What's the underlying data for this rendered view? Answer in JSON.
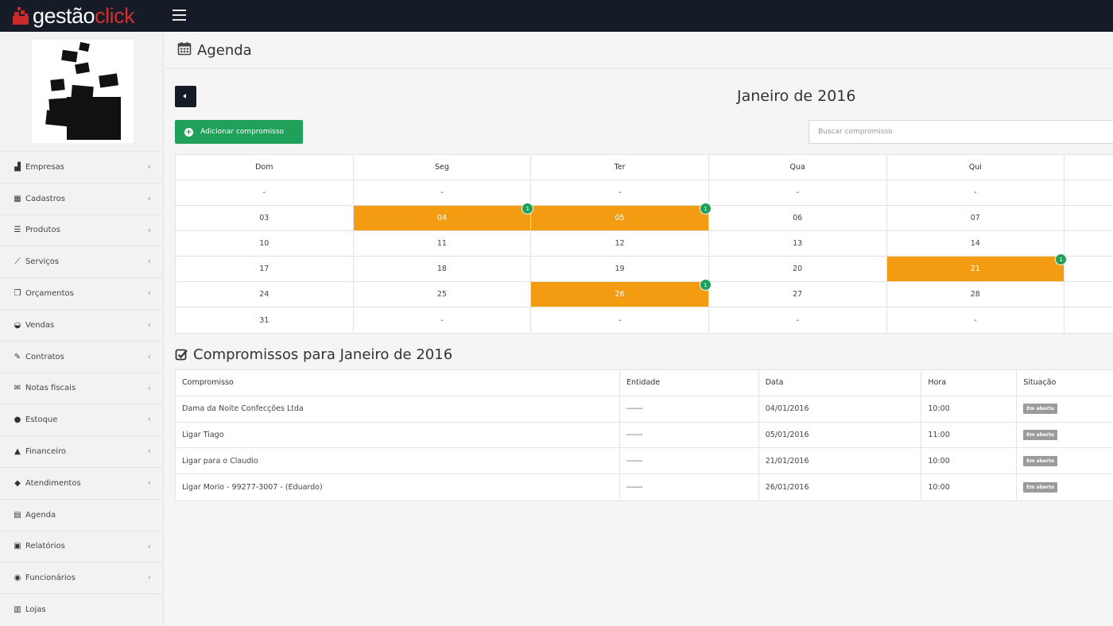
{
  "topbar": {
    "brand_part1": "gestão",
    "brand_part2": "click"
  },
  "sidebar": {
    "items": [
      {
        "label": "Empresas",
        "icon": "bar-chart-icon",
        "chevron": true
      },
      {
        "label": "Cadastros",
        "icon": "table-icon",
        "chevron": true
      },
      {
        "label": "Produtos",
        "icon": "list-icon",
        "chevron": true
      },
      {
        "label": "Serviços",
        "icon": "wrench-icon",
        "chevron": true
      },
      {
        "label": "Orçamentos",
        "icon": "copy-icon",
        "chevron": true
      },
      {
        "label": "Vendas",
        "icon": "basket-icon",
        "chevron": true
      },
      {
        "label": "Contratos",
        "icon": "edit-icon",
        "chevron": true
      },
      {
        "label": "Notas fiscais",
        "icon": "invoice-icon",
        "chevron": true
      },
      {
        "label": "Estoque",
        "icon": "globe-icon",
        "chevron": true
      },
      {
        "label": "Financeiro",
        "icon": "bank-icon",
        "chevron": true
      },
      {
        "label": "Atendimentos",
        "icon": "comments-icon",
        "chevron": true
      },
      {
        "label": "Agenda",
        "icon": "calendar-icon",
        "chevron": false
      },
      {
        "label": "Relatórios",
        "icon": "report-icon",
        "chevron": true
      },
      {
        "label": "Funcionários",
        "icon": "user-icon",
        "chevron": true
      },
      {
        "label": "Lojas",
        "icon": "store-icon",
        "chevron": false
      }
    ]
  },
  "page": {
    "title": "Agenda"
  },
  "calendar": {
    "month_label": "Janeiro de 2016",
    "add_button": "Adicionar compromisso",
    "search_placeholder": "Buscar compromisso",
    "headers": [
      "Dom",
      "Seg",
      "Ter",
      "Qua",
      "Qui"
    ],
    "weeks": [
      [
        {
          "d": "-"
        },
        {
          "d": "-"
        },
        {
          "d": "-"
        },
        {
          "d": "-"
        },
        {
          "d": "-"
        }
      ],
      [
        {
          "d": "03"
        },
        {
          "d": "04",
          "events": "1"
        },
        {
          "d": "05",
          "events": "1"
        },
        {
          "d": "06"
        },
        {
          "d": "07"
        }
      ],
      [
        {
          "d": "10"
        },
        {
          "d": "11"
        },
        {
          "d": "12"
        },
        {
          "d": "13"
        },
        {
          "d": "14"
        }
      ],
      [
        {
          "d": "17"
        },
        {
          "d": "18"
        },
        {
          "d": "19"
        },
        {
          "d": "20"
        },
        {
          "d": "21",
          "events": "1"
        }
      ],
      [
        {
          "d": "24"
        },
        {
          "d": "25"
        },
        {
          "d": "26",
          "events": "1"
        },
        {
          "d": "27"
        },
        {
          "d": "28"
        }
      ],
      [
        {
          "d": "31"
        },
        {
          "d": "-"
        },
        {
          "d": "-"
        },
        {
          "d": "-"
        },
        {
          "d": "-"
        }
      ]
    ],
    "event_color": "#f39c12",
    "badge_color": "#1fa15a"
  },
  "appointments": {
    "title": "Compromissos para Janeiro de 2016",
    "columns": [
      "Compromisso",
      "Entidade",
      "Data",
      "Hora",
      "Situação"
    ],
    "rows": [
      [
        "Dama da Noite Confecções Ltda",
        "------",
        "04/01/2016",
        "10:00",
        "Em aberto"
      ],
      [
        "Ligar Tiago",
        "------",
        "05/01/2016",
        "11:00",
        "Em aberto"
      ],
      [
        "Ligar para o Claudio",
        "------",
        "21/01/2016",
        "10:00",
        "Em aberto"
      ],
      [
        "Ligar Morio - 99277-3007 - (Eduardo)",
        "------",
        "26/01/2016",
        "10:00",
        "Em aberto"
      ]
    ]
  }
}
